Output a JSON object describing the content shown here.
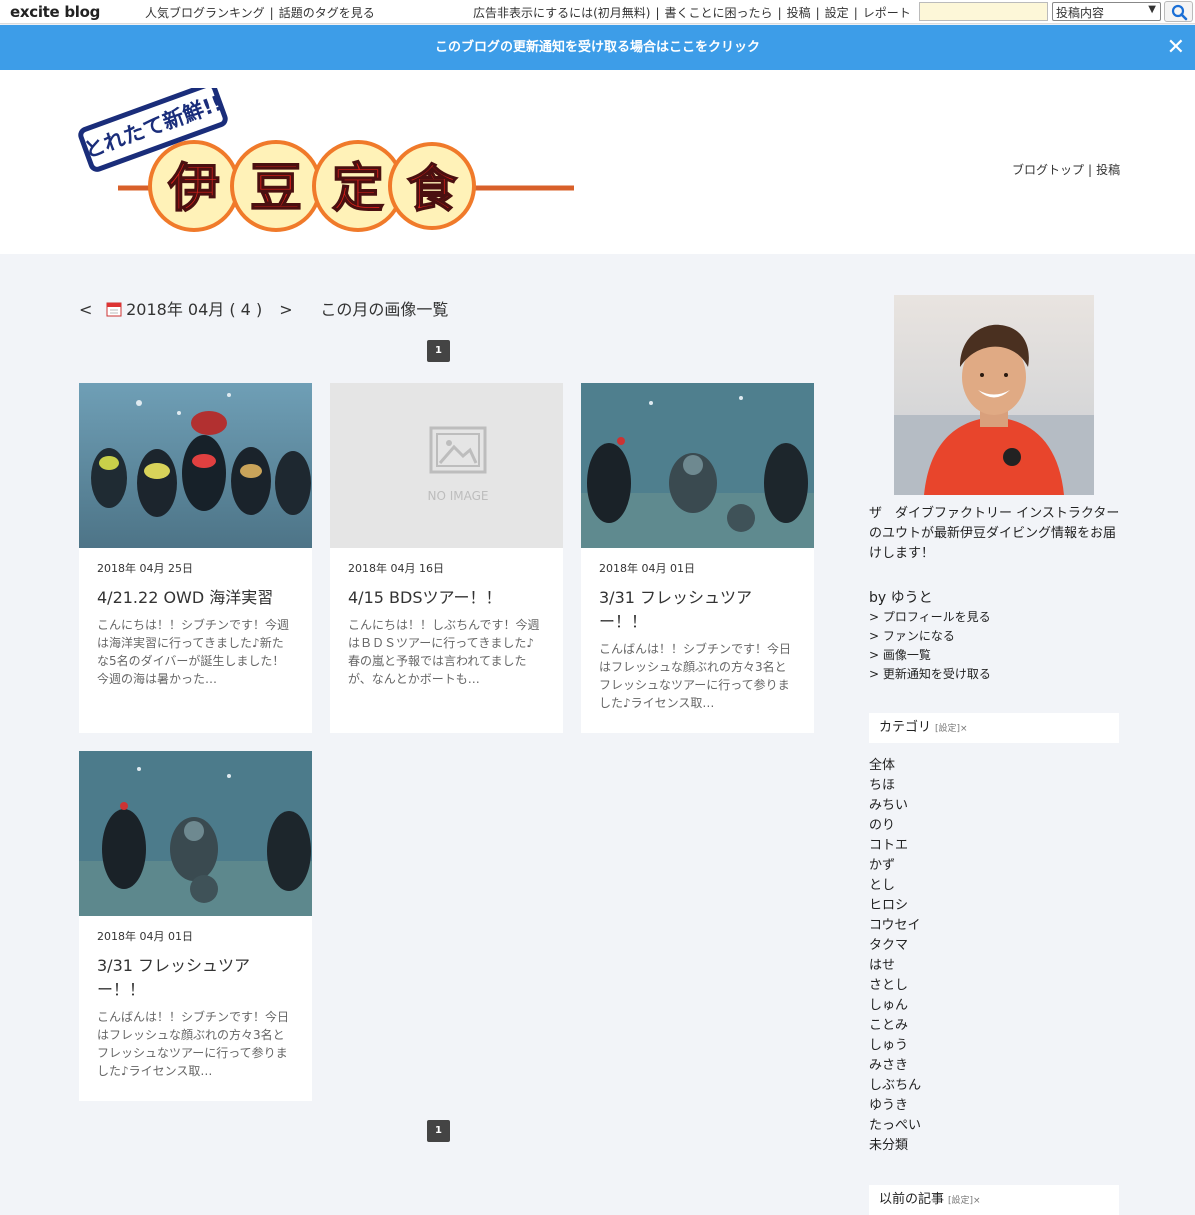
{
  "topbar": {
    "logo": "excite blog",
    "left_links": [
      "人気ブログランキング",
      "話題のタグを見る"
    ],
    "right_links": [
      "広告非表示にするには(初月無料)",
      "書くことに困ったら",
      "投稿",
      "設定",
      "レポート"
    ],
    "search_value": "",
    "search_select": "投稿内容",
    "search_icon": "search-icon"
  },
  "notice": {
    "text": "このブログの更新通知を受け取る場合はここをクリック",
    "close": "✕"
  },
  "header": {
    "banner": {
      "tagline": "とれたて新鮮!!",
      "chars": [
        "伊",
        "豆",
        "定",
        "食"
      ]
    },
    "nav": [
      "ブログトップ",
      "投稿"
    ]
  },
  "month_nav": {
    "prev": "<",
    "next": ">",
    "label": "2018年 04月 ( 4 )",
    "image_list": "この月の画像一覧"
  },
  "pagination": {
    "current": "1"
  },
  "posts": [
    {
      "date": "2018年 04月 25日",
      "title": "4/21.22 OWD 海洋実習",
      "excerpt": "こんにちは！！シブチンです！今週は海洋実習に行ってきました♪新たな5名のダイバーが誕生しました！今週の海は暑かった…",
      "thumb": "diving-photo"
    },
    {
      "date": "2018年 04月 16日",
      "title": "4/15 BDSツアー！！",
      "excerpt": "こんにちは！！しぶちんです！今週はＢＤＳツアーに行ってきました♪春の嵐と予報では言われてましたが、なんとかボートも…",
      "thumb": "no-image",
      "no_image_label": "NO IMAGE"
    },
    {
      "date": "2018年 04月 01日",
      "title": "3/31 フレッシュツアー！！",
      "excerpt": "こんばんは！！シブチンです！今日はフレッシュな顔ぶれの方々3名とフレッシュなツアーに行って参りました♪ライセンス取…",
      "thumb": "diving-photo"
    },
    {
      "date": "2018年 04月 01日",
      "title": "3/31 フレッシュツアー！！",
      "excerpt": "こんばんは！！シブチンです！今日はフレッシュな顔ぶれの方々3名とフレッシュなツアーに行って参りました♪ライセンス取…",
      "thumb": "diving-photo"
    }
  ],
  "sidebar": {
    "description": "ザ　ダイブファクトリー インストラクターのユウトが最新伊豆ダイビング情報をお届けします！",
    "by": "by ゆうと",
    "profile_links": [
      "> プロフィールを見る",
      "> ファンになる",
      "> 画像一覧",
      "> 更新通知を受け取る"
    ],
    "category_title": "カテゴリ",
    "settings_label": "[設定]×",
    "categories": [
      "全体",
      "ちほ",
      "みちい",
      "のり",
      "コトエ",
      "かず",
      "とし",
      "ヒロシ",
      "コウセイ",
      "タクマ",
      "はせ",
      "さとし",
      "しゅん",
      "ことみ",
      "しゅう",
      "みさき",
      "しぶちん",
      "ゆうき",
      "たっぺい",
      "未分類"
    ],
    "archive_title": "以前の記事"
  },
  "colors": {
    "notice_bg": "#3d9de8",
    "banner_orange": "#f07a2a",
    "banner_red": "#e0201a",
    "banner_navy": "#1a2d7a"
  }
}
